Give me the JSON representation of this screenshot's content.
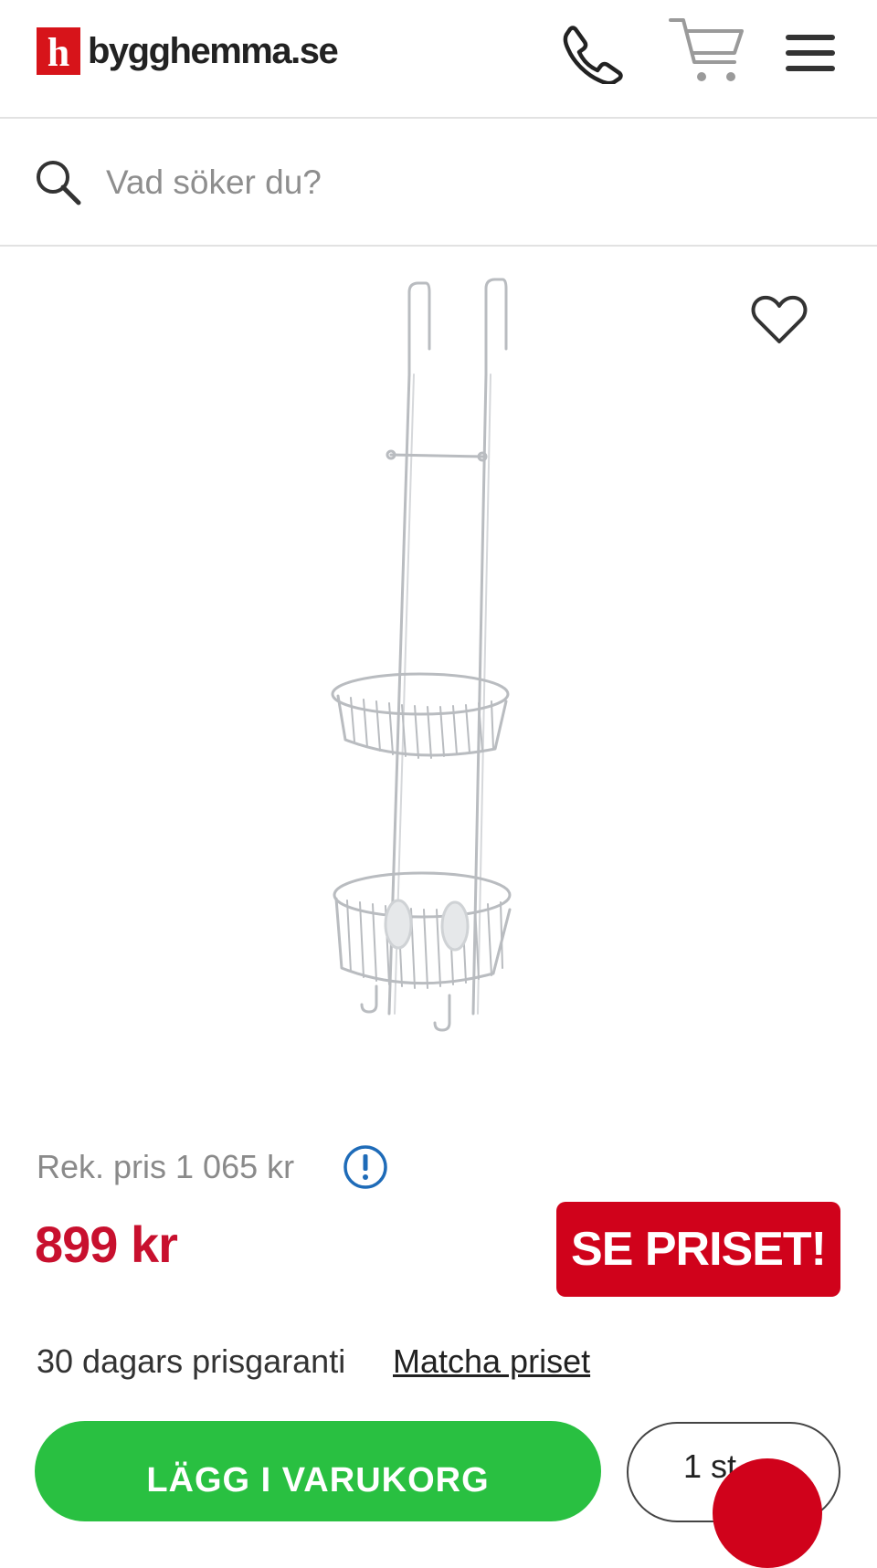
{
  "header": {
    "logo_letter": "h",
    "logo_text": "bygghemma.se",
    "icons": [
      "phone-icon",
      "cart-icon",
      "hamburger-menu-icon"
    ]
  },
  "search": {
    "placeholder": "Vad söker du?",
    "value": ""
  },
  "product": {
    "image_icon": "shower-caddy-image",
    "favorite_icon": "heart-icon"
  },
  "pricing": {
    "recommended_price": "Rek. pris 1 065 kr",
    "price": "899 kr",
    "promo_button": "SE PRISET!",
    "guarantee": "30 dagars prisgaranti",
    "match_link": "Matcha priset"
  },
  "actions": {
    "add_to_cart": "LÄGG I VARUKORG",
    "quantity": "1 st"
  },
  "colors": {
    "brand_red": "#d0021b",
    "price_red": "#c8102e",
    "cta_green": "#29c041"
  }
}
